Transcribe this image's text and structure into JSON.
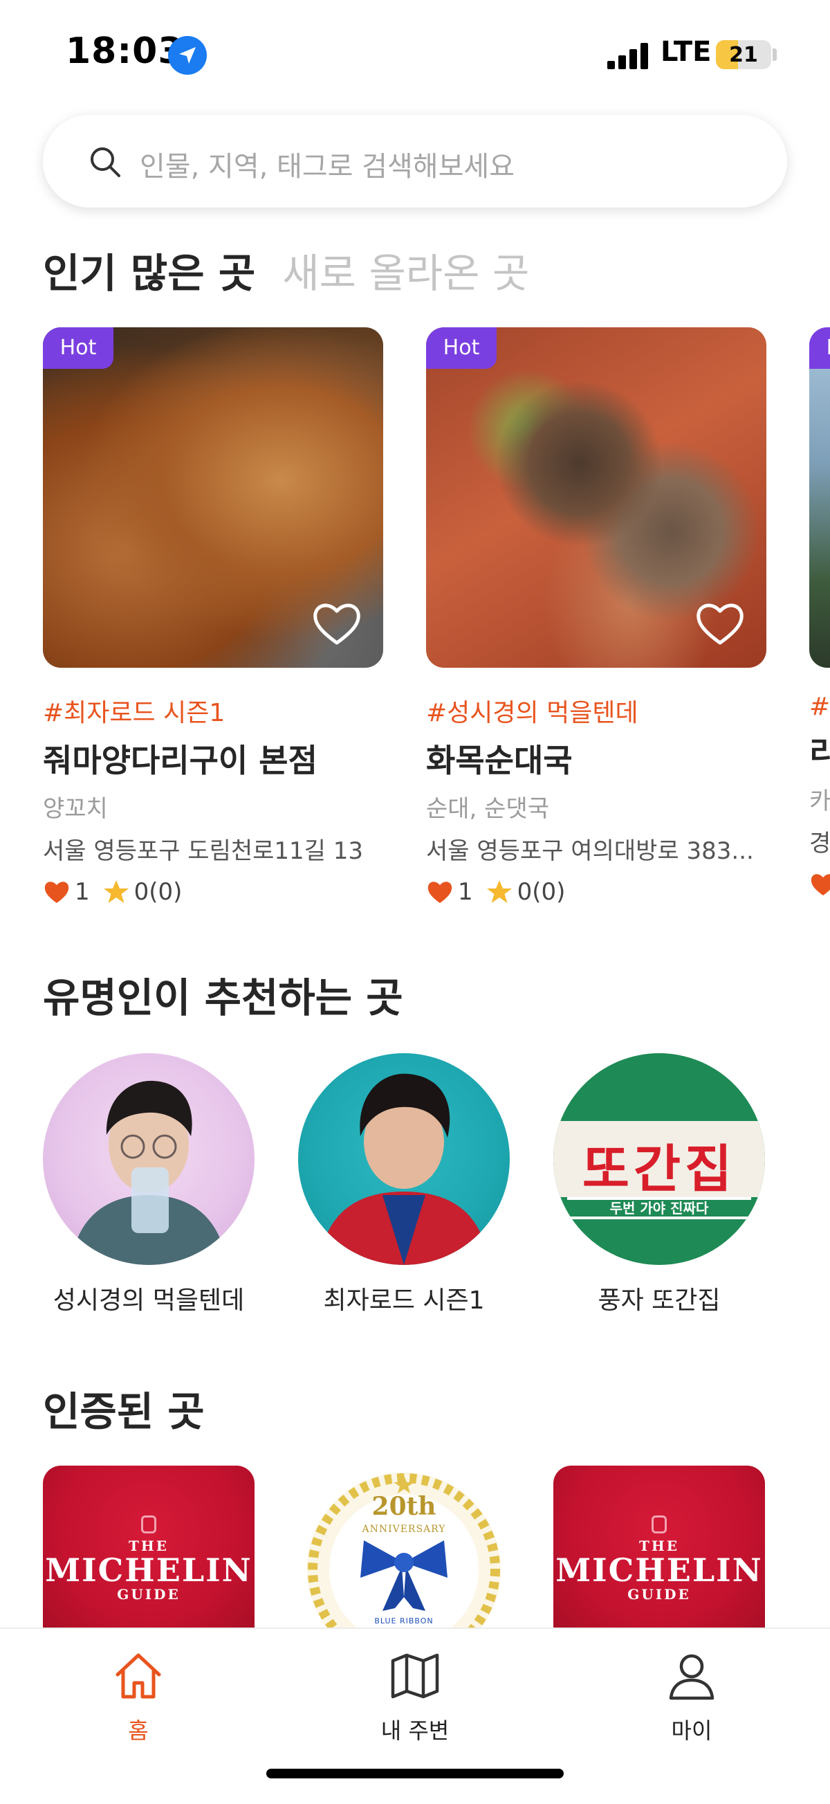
{
  "status_bar": {
    "time": "18:03",
    "network": "LTE",
    "battery": "21",
    "battery_level": 0.21
  },
  "search": {
    "placeholder": "인물, 지역, 태그로 검색해보세요"
  },
  "tabs": [
    {
      "label": "인기 많은 곳",
      "active": true
    },
    {
      "label": "새로 올라온 곳",
      "active": false
    }
  ],
  "places": [
    {
      "badge": "Hot",
      "tag": "#최자로드 시즌1",
      "name": "줘마양다리구이 본점",
      "category": "양꼬치",
      "address": "서울 영등포구 도림천로11길 13",
      "likes": "1",
      "rating": "0(0)"
    },
    {
      "badge": "Hot",
      "tag": "#성시경의 먹을텐데",
      "name": "화목순대국",
      "category": "순대, 순댓국",
      "address": "서울 영등포구 여의대방로 383...",
      "likes": "1",
      "rating": "0(0)"
    },
    {
      "badge": "Hot",
      "tag": "#",
      "name": "리",
      "category": "카",
      "address": "경",
      "likes": "",
      "rating": ""
    }
  ],
  "celebrity_section": {
    "title": "유명인이 추천하는 곳",
    "items": [
      {
        "name": "성시경의 먹을텐데"
      },
      {
        "name": "최자로드 시즌1"
      },
      {
        "name": "풍자 또간집",
        "logo_text": "또간집",
        "logo_sub": "두번 가야 진짜다"
      }
    ]
  },
  "certified_section": {
    "title": "인증된 곳",
    "items": [
      {
        "line1": "THE",
        "line2": "MICHELIN",
        "line3": "GUIDE"
      },
      {
        "line1": "20th",
        "line2": "ANNIVERSARY",
        "line3": "BLUE RIBBON"
      },
      {
        "line1": "THE",
        "line2": "MICHELIN",
        "line3": "GUIDE"
      }
    ]
  },
  "bottom_nav": [
    {
      "label": "홈",
      "icon": "home-icon",
      "active": true
    },
    {
      "label": "내 주변",
      "icon": "map-icon",
      "active": false
    },
    {
      "label": "마이",
      "icon": "user-icon",
      "active": false
    }
  ],
  "colors": {
    "accent": "#e8541e",
    "hot_badge": "#7a3fe0",
    "star": "#f5b82e",
    "michelin_red": "#c4122f"
  }
}
